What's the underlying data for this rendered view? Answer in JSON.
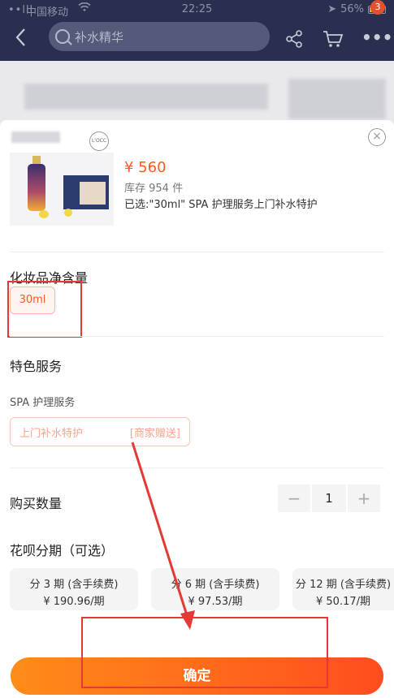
{
  "status_bar": {
    "signal": "••lll",
    "carrier": "中国移动",
    "time": "22:25",
    "battery": "56%"
  },
  "nav": {
    "search_placeholder": "补水精华",
    "badge_count": "3"
  },
  "product": {
    "price": "¥ 560",
    "stock": "库存 954 件",
    "selected": "已选:\"30ml\"   SPA 护理服务上门补水特护",
    "close": "×"
  },
  "volume_section": {
    "title": "化妆品净含量",
    "option": "30ml"
  },
  "service_section": {
    "title": "特色服务",
    "sub_label": "SPA 护理服务",
    "option_label": "上门补水特护",
    "option_tag": "[商家赠送]"
  },
  "quantity": {
    "title": "购买数量",
    "minus": "−",
    "value": "1",
    "plus": "+"
  },
  "installment": {
    "title": "花呗分期（可选）",
    "plans": [
      {
        "label": "分 3 期 (含手续费)",
        "amount": "¥ 190.96/期"
      },
      {
        "label": "分 6 期 (含手续费)",
        "amount": "¥ 97.53/期"
      },
      {
        "label": "分 12 期 (含手续费)",
        "amount": "¥ 50.17/期"
      }
    ]
  },
  "confirm_button": "确定",
  "colors": {
    "accent": "#ff5a1e",
    "annotation": "#e53935",
    "topbar": "#2b2f4f"
  }
}
